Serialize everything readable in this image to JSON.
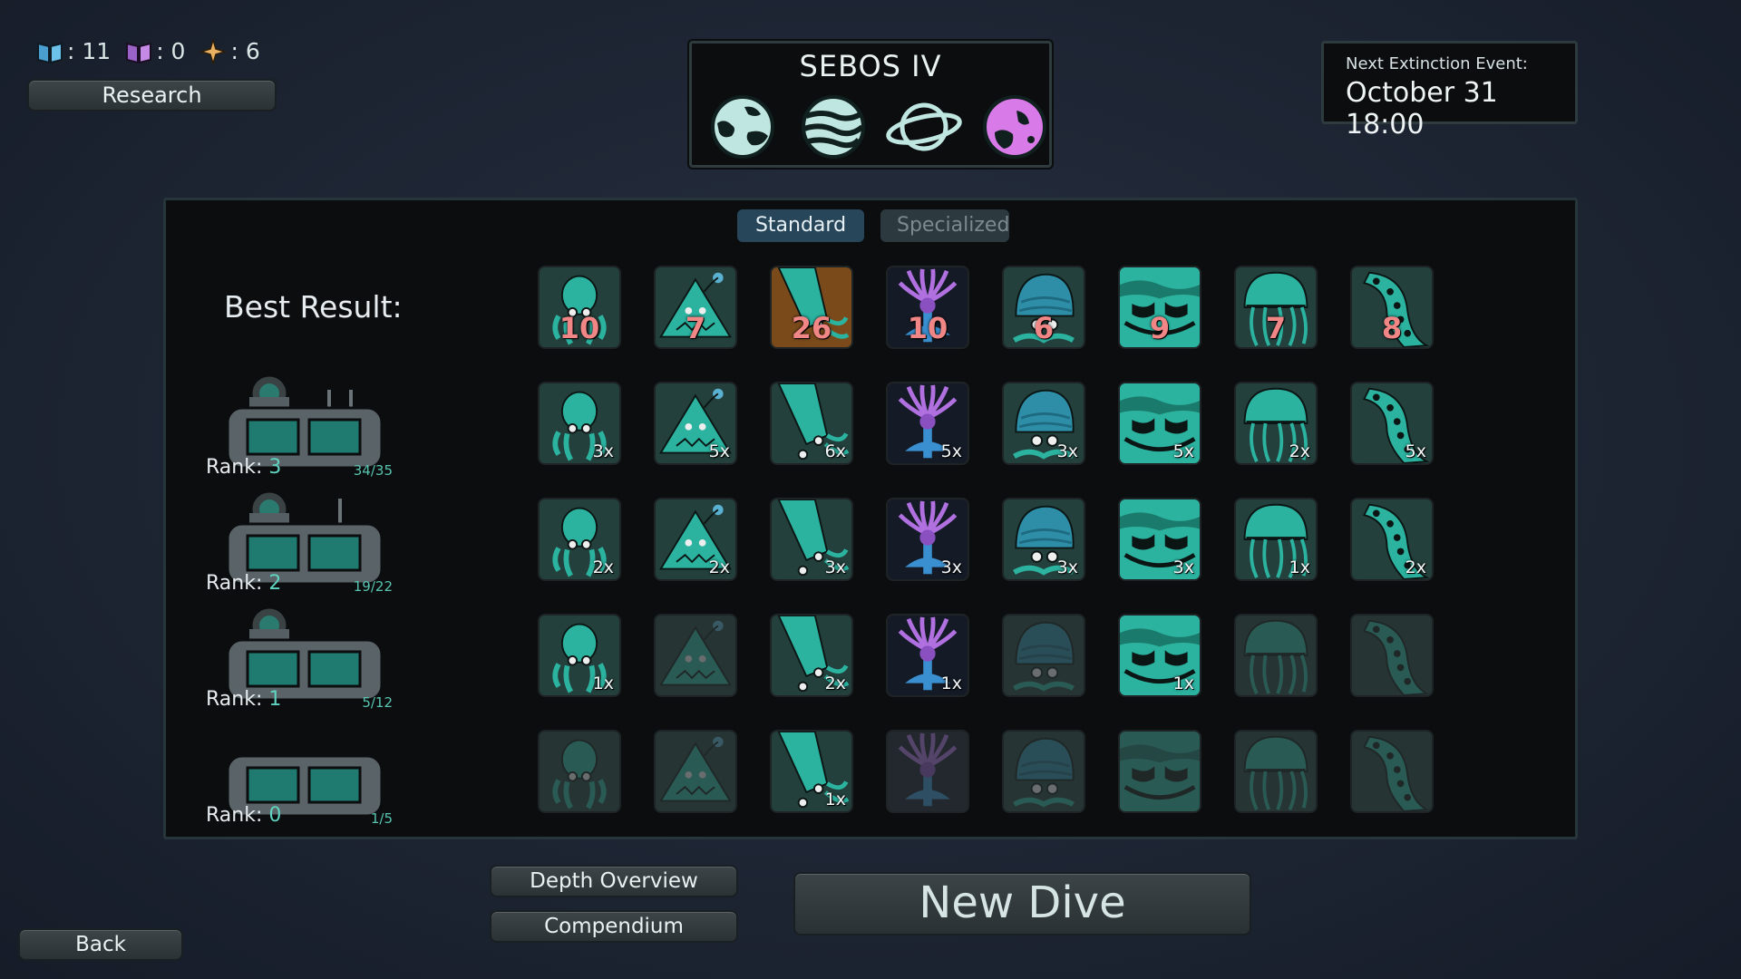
{
  "resources": [
    {
      "icon": "blue-book-icon",
      "color": "#5ab0e0",
      "value": ": 11"
    },
    {
      "icon": "purple-book-icon",
      "color": "#b07ad8",
      "value": ": 0"
    },
    {
      "icon": "star-icon",
      "color": "#e8b060",
      "value": ": 6"
    }
  ],
  "research_label": "Research",
  "planet": {
    "name": "SEBOS IV",
    "planets": [
      {
        "icon": "continents-planet-icon",
        "selected": false
      },
      {
        "icon": "gas-giant-planet-icon",
        "selected": false
      },
      {
        "icon": "ringed-planet-icon",
        "selected": false
      },
      {
        "icon": "ocean-planet-icon",
        "selected": true
      }
    ]
  },
  "extinction": {
    "label": "Next Extinction Event:",
    "value": "October 31 18:00"
  },
  "tabs": {
    "standard": "Standard",
    "specialized": "Specialized"
  },
  "best_result_label": "Best Result:",
  "creatures": [
    "octopus",
    "anglerfish",
    "squid",
    "purple-flower-creature",
    "hermit-crab",
    "maw-creature",
    "jellyfish",
    "tentacle"
  ],
  "best_results": [
    "10",
    "7",
    "26",
    "10",
    "6",
    "9",
    "7",
    "8"
  ],
  "ranks": [
    {
      "label": "Rank:",
      "num": "3",
      "progress": "34/35",
      "counts": [
        "3x",
        "5x",
        "6x",
        "5x",
        "3x",
        "5x",
        "2x",
        "5x"
      ]
    },
    {
      "label": "Rank:",
      "num": "2",
      "progress": "19/22",
      "counts": [
        "2x",
        "2x",
        "3x",
        "3x",
        "3x",
        "3x",
        "1x",
        "2x"
      ]
    },
    {
      "label": "Rank:",
      "num": "1",
      "progress": "5/12",
      "counts": [
        "1x",
        "",
        "2x",
        "1x",
        "",
        "1x",
        "",
        ""
      ]
    },
    {
      "label": "Rank:",
      "num": "0",
      "progress": "1/5",
      "counts": [
        "",
        "",
        "1x",
        "",
        "",
        "",
        "",
        ""
      ]
    }
  ],
  "buttons": {
    "depth_overview": "Depth Overview",
    "compendium": "Compendium",
    "new_dive": "New Dive",
    "back": "Back"
  }
}
